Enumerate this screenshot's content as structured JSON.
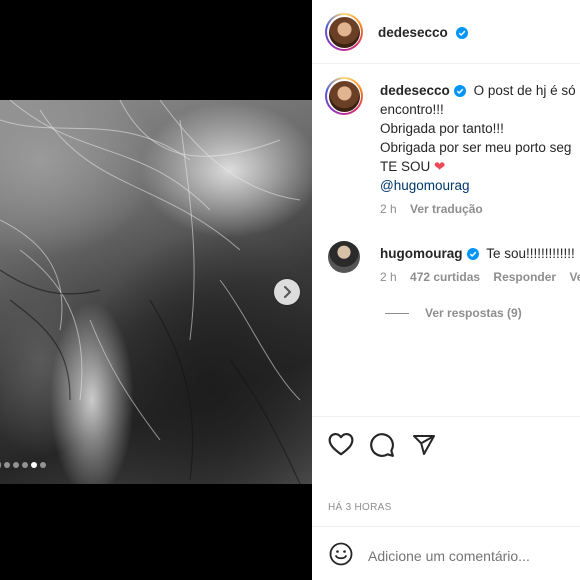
{
  "post": {
    "author": "dedesecco",
    "media_dots": 6,
    "media_active_index": 4
  },
  "caption": {
    "author": "dedesecco",
    "lines": [
      "O post de hj é só",
      "encontro!!!",
      "Obrigada por tanto!!!",
      "Obrigada por ser meu porto seg",
      "TE SOU"
    ],
    "heart": "❤",
    "mention": "@hugomourag",
    "time": "2 h",
    "translate_label": "Ver tradução"
  },
  "comment": {
    "author": "hugomourag",
    "text": "Te sou!!!!!!!!!!!!!",
    "time": "2 h",
    "likes": "472 curtidas",
    "reply_label": "Responder",
    "more_label": "Ver",
    "view_replies_label": "Ver respostas (9)"
  },
  "actions": {
    "timestamp": "HÁ 3 HORAS"
  },
  "composer": {
    "placeholder": "Adicione um comentário..."
  },
  "colors": {
    "verified": "#0095f6",
    "heart": "#ed4956",
    "mention": "#00376b"
  }
}
